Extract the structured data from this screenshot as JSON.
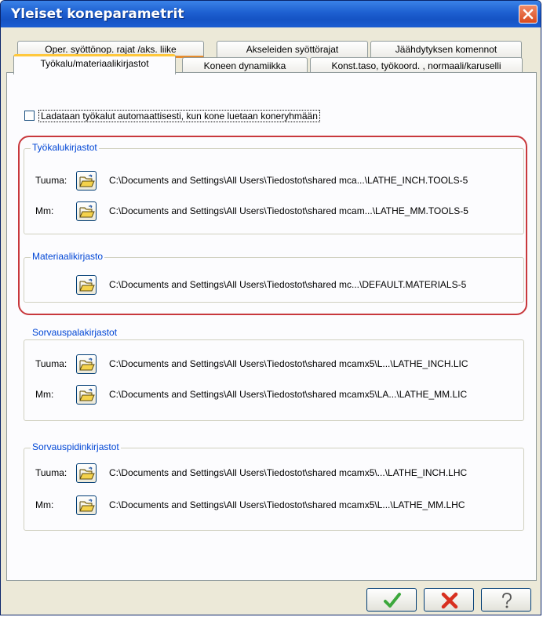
{
  "window": {
    "title": "Yleiset koneparametrit"
  },
  "tabs": {
    "row1": [
      {
        "label": "Oper. syöttönop. rajat /aks. liike"
      },
      {
        "label": "Akseleiden syöttörajat"
      },
      {
        "label": "Jäähdytyksen komennot"
      }
    ],
    "row2": [
      {
        "label": "Työkalu/materiaalikirjastot",
        "active": true
      },
      {
        "label": "Koneen dynamiikka"
      },
      {
        "label": "Konst.taso, työkoord. , normaali/karuselli"
      }
    ]
  },
  "auto_load": {
    "checked": false,
    "label": "Ladataan työkalut automaattisesti, kun kone luetaan koneryhmään"
  },
  "tool_libraries": {
    "title": "Työkalukirjastot",
    "rows": [
      {
        "label": "Tuuma:",
        "path": "C:\\Documents and Settings\\All Users\\Tiedostot\\shared mca...\\LATHE_INCH.TOOLS-5"
      },
      {
        "label": "Mm:",
        "path": "C:\\Documents and Settings\\All Users\\Tiedostot\\shared mcam...\\LATHE_MM.TOOLS-5"
      }
    ]
  },
  "material_library": {
    "title": "Materiaalikirjasto",
    "path": "C:\\Documents and Settings\\All Users\\Tiedostot\\shared mc...\\DEFAULT.MATERIALS-5"
  },
  "insert_libraries": {
    "title": "Sorvauspalakirjastot",
    "rows": [
      {
        "label": "Tuuma:",
        "path": "C:\\Documents and Settings\\All Users\\Tiedostot\\shared mcamx5\\L...\\LATHE_INCH.LIC"
      },
      {
        "label": "Mm:",
        "path": "C:\\Documents and Settings\\All Users\\Tiedostot\\shared mcamx5\\LA...\\LATHE_MM.LIC"
      }
    ]
  },
  "holder_libraries": {
    "title": "Sorvauspidinkirjastot",
    "rows": [
      {
        "label": "Tuuma:",
        "path": "C:\\Documents and Settings\\All Users\\Tiedostot\\shared mcamx5\\...\\LATHE_INCH.LHC"
      },
      {
        "label": "Mm:",
        "path": "C:\\Documents and Settings\\All Users\\Tiedostot\\shared mcamx5\\L...\\LATHE_MM.LHC"
      }
    ]
  },
  "buttons": {
    "ok_icon": "green-checkmark-icon",
    "cancel_icon": "red-x-icon",
    "help_icon": "question-mark-icon"
  },
  "colors": {
    "titlebar": "#1d5fd0",
    "group_title": "#0046d5",
    "highlight": "#c8383c",
    "ok": "#3ca83c",
    "cancel": "#d83020"
  }
}
